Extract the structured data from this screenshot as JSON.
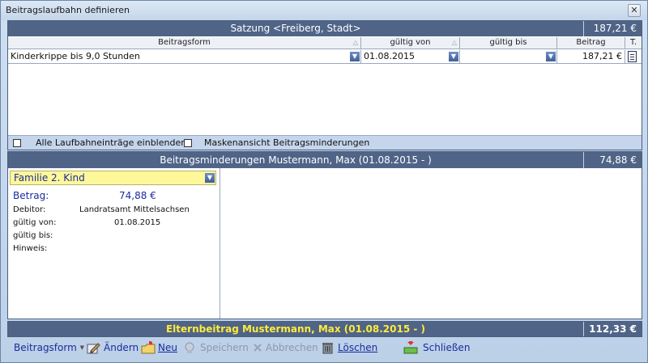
{
  "window": {
    "title": "Beitragslaufbahn definieren",
    "close": "✕"
  },
  "top": {
    "header": "Satzung <Freiberg, Stadt>",
    "header_amount": "187,21 €",
    "columns": [
      "Beitragsform",
      "gültig von",
      "gültig bis",
      "Beitrag",
      "T."
    ],
    "row": {
      "beitragsform": "Kinderkrippe bis 9,0 Stunden",
      "gueltig_von": "01.08.2015",
      "gueltig_bis": "",
      "beitrag": "187,21 €"
    },
    "checkboxes": [
      {
        "label": "Alle Laufbahneinträge einblenden",
        "checked": false
      },
      {
        "label": "Maskenansicht Beitragsminderungen",
        "checked": false
      }
    ]
  },
  "reductions": {
    "header": "Beitragsminderungen Mustermann, Max (01.08.2015 - )",
    "header_amount": "74,88 €",
    "selected": "Familie 2. Kind",
    "betrag_label": "Betrag:",
    "betrag_value": "74,88 €",
    "debitor_label": "Debitor:",
    "debitor_value": "Landratsamt Mittelsachsen",
    "von_label": "gültig von:",
    "von_value": "01.08.2015",
    "bis_label": "gültig bis:",
    "bis_value": "",
    "hinweis_label": "Hinweis:",
    "hinweis_value": ""
  },
  "footer": {
    "text": "Elternbeitrag Mustermann, Max (01.08.2015 - )",
    "amount": "112,33 €"
  },
  "toolbar": {
    "beitragsform": "Beitragsform",
    "aendern": "Ändern",
    "neu": "Neu",
    "speichern": "Speichern",
    "abbrechen": "Abbrechen",
    "loeschen": "Löschen",
    "schliessen": "Schließen"
  },
  "colors": {
    "header_bar": "#4f6487",
    "footer_text": "#ffeb3b",
    "selected_fill": "#fff89a",
    "link_text": "#1b2b9c"
  }
}
